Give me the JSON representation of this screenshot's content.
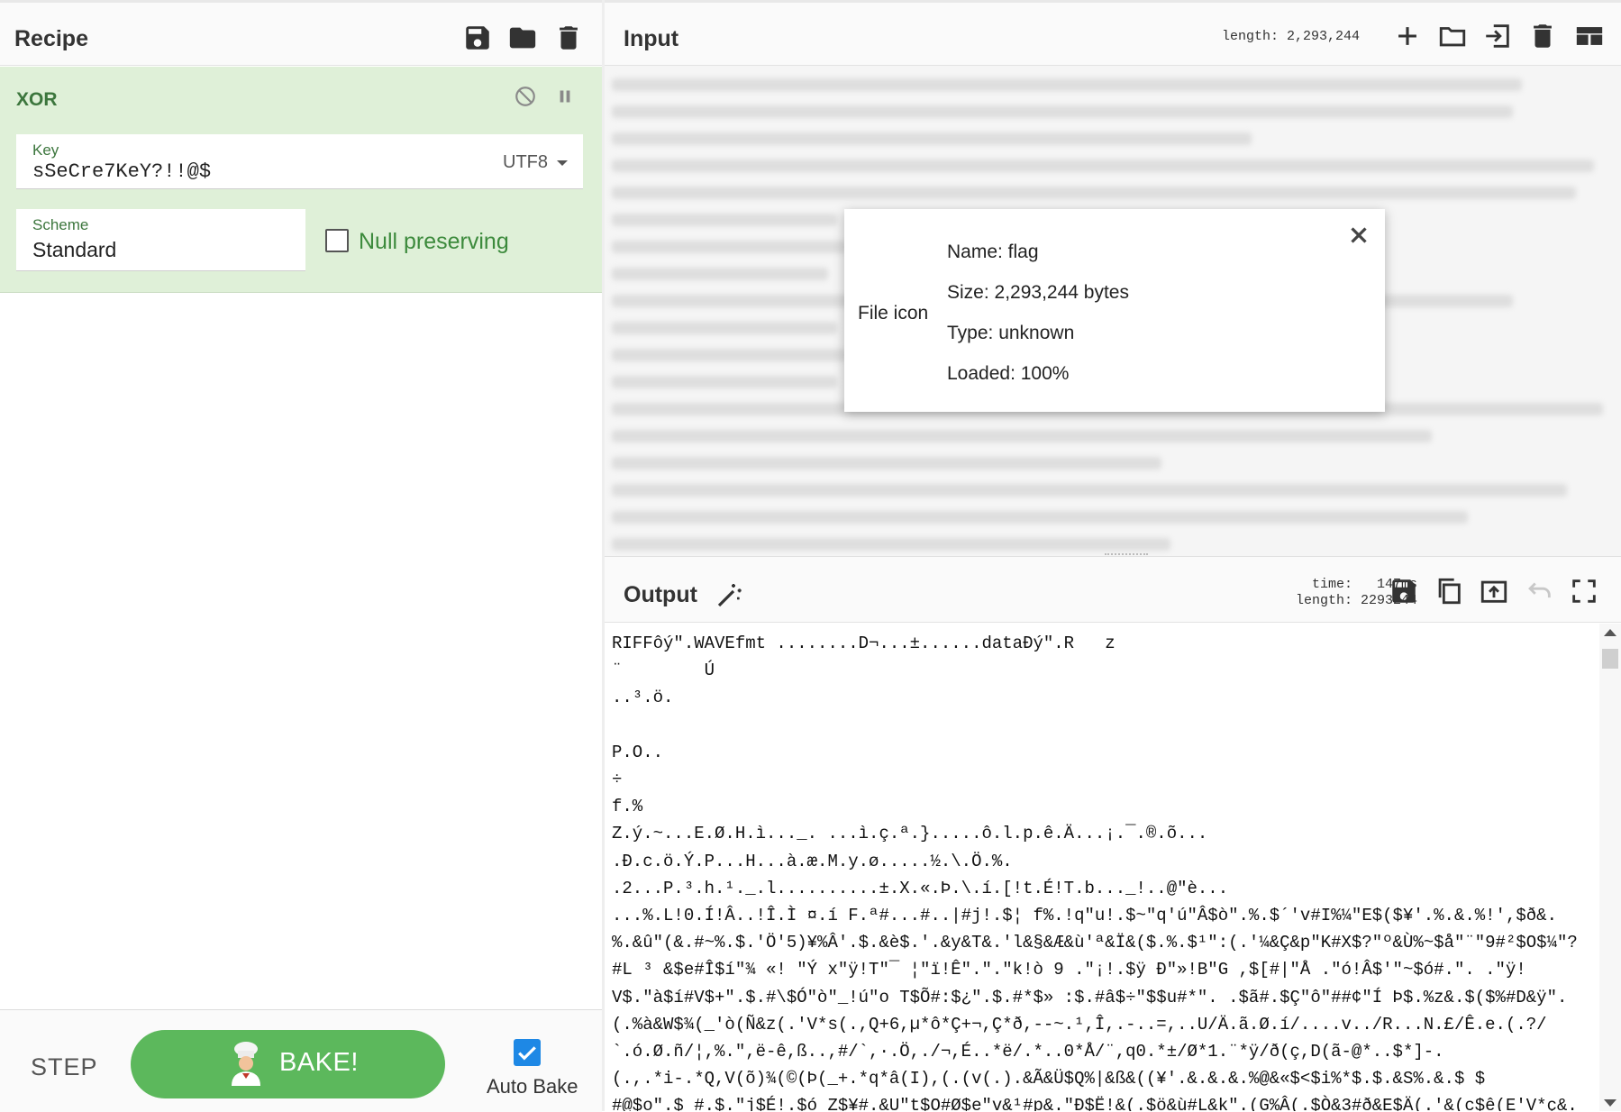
{
  "recipe": {
    "title": "Recipe",
    "save_icon": "save-icon",
    "load_icon": "folder-icon",
    "clear_icon": "trash-icon"
  },
  "operation": {
    "name": "XOR",
    "key": {
      "label": "Key",
      "value": "sSeCre7KeY?!!@$",
      "encoding": "UTF8"
    },
    "scheme": {
      "label": "Scheme",
      "value": "Standard"
    },
    "null_preserving": {
      "label": "Null preserving",
      "checked": false
    }
  },
  "controls": {
    "step_label": "STEP",
    "bake_label": "BAKE!",
    "auto_bake_label": "Auto Bake",
    "auto_bake_checked": true
  },
  "input": {
    "title": "Input",
    "length_text": "length: 2,293,244"
  },
  "file_details": {
    "icon_alt": "File icon",
    "name": "Name: flag",
    "size": "Size: 2,293,244 bytes",
    "type": "Type: unknown",
    "loaded": "Loaded: 100%",
    "loaded_fraction": 1.0
  },
  "output": {
    "title": "Output",
    "time_label": "time:",
    "time_value": "147ms",
    "length_label": "length:",
    "length_value": "2293244",
    "lines": [
      "RIFFôý\".WAVEfmt ........D¬...±......dataÐý\".R   z",
      "¨        Ú",
      "..³.ö.",
      "",
      "P.O..",
      "÷",
      "f.%",
      "Z.ý.~...E.Ø.H.ì..._. ...ì.ç.ª.}.....ô.l.p.ê.Ä...¡.¯.®.õ...",
      ".Ð.c.ö.Ý.P...H...à.æ.M.y.ø.....½.\\.Ö.%.",
      ".2...P.³.h.¹._.l..........±.X.«.Þ.\\.í.[!t.É!T.b..._!..@\"è...",
      "...%.L!0.Í!Â..!Î.Ì ¤.í F.ª#...#..|#j!.$¦ f%.!q\"u!.$~\"q'ú\"Â$ò\".%.$´'v#I%¼\"E$($¥'.%.&.%!',$ð&.",
      "%.&û\"(&.#~%.$.'Ö'5)¥%Â'.$.&è$.'.&y&T&.'l&§&Æ&ù'ª&Ï&($.%.$¹\":(.'¼&Ç&p\"K#X$?\"º&Ù%~$å\"¨\"9#²$O$¼\"?",
      "#L ³ &$e#Î$í\"¾ «! \"Ý x\"ÿ!T\"¯ ¦\"ï!Ê\".\".\"k!ò 9 .\"¡!.$ÿ Ð\"»!B\"G ,$[#|\"Å .\"ó!Â$'\"~$ó#.\". .\"ÿ!",
      "V$.\"à$í#V$+\".$.#\\$Ó\"ò\"_!ú\"o T$Õ#:$¿\".$.#*$» :$.#â$÷\"$$u#*\". .$ã#.$Ç\"ô\"##¢\"Í Þ$.%z&.$($%#D&ÿ\".",
      "(.%à&W$¾(_'ò(Ñ&z(.'V*s(.,Q+6,µ*ô*Ç+¬,Ç*ð,--~.¹,Î,.-..=,..U/Ä.ã.Ø.í/....v../R...N.£/Ê.e.(.?/",
      "`.ó.Ø.ñ/¦,%.\",ë-ê,ß..,#/`,·.Ö,./¬,É..*ë/.*..0*Å/¨,q0.*±/Ø*1.¨*ÿ/ð(ç,D(ã-@*..$*]-.",
      "(.,.*i-.*Q,V(õ)¾(©(Þ(_+.*q*â(I),(.(v(.).&Ã&Ü$Q%|&ß&((¥'.&.&.&.%@&«$<$i%*$.$.&S%.&.$ $",
      "#@$o\".$_#.$.\"j$É!.$ó Z$¥#.&U\"t$O#Ø$e\"v&¹#p&.\"Ð$Ë!&(.$ö&ù#L&k\".(G%Â(.$Ò&3#ð&E$Ä(.'&(c$ê(E'V*ç&."
    ]
  }
}
